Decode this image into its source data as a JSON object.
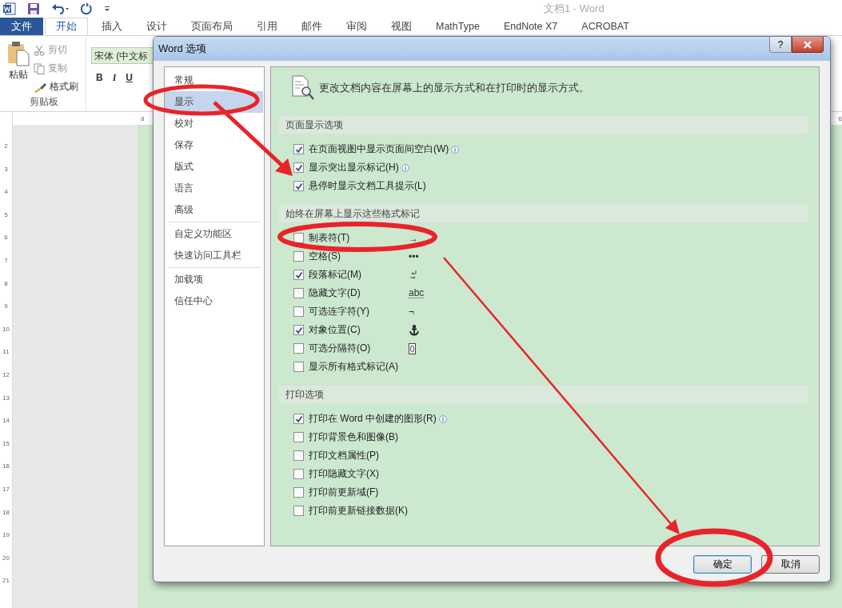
{
  "app": {
    "title": "文档1 - Word"
  },
  "tabs": [
    {
      "label": "文件",
      "kind": "file",
      "selected": false
    },
    {
      "label": "开始",
      "kind": "tab",
      "selected": true
    },
    {
      "label": "插入",
      "kind": "tab",
      "selected": false
    },
    {
      "label": "设计",
      "kind": "tab",
      "selected": false
    },
    {
      "label": "页面布局",
      "kind": "tab",
      "selected": false
    },
    {
      "label": "引用",
      "kind": "tab",
      "selected": false
    },
    {
      "label": "邮件",
      "kind": "tab",
      "selected": false
    },
    {
      "label": "审阅",
      "kind": "tab",
      "selected": false
    },
    {
      "label": "视图",
      "kind": "tab",
      "selected": false
    },
    {
      "label": "MathType",
      "kind": "tab",
      "selected": false
    },
    {
      "label": "EndNote X7",
      "kind": "tab",
      "selected": false
    },
    {
      "label": "ACROBAT",
      "kind": "tab",
      "selected": false
    }
  ],
  "clipboard": {
    "paste": "粘贴",
    "cut": "剪切",
    "copy": "复制",
    "format_painter": "格式刷",
    "group_label": "剪贴板"
  },
  "font": {
    "value": "宋体 (中文标",
    "bold": "B",
    "italic": "I",
    "underline": "U"
  },
  "ruler": {
    "top_labels": [
      "8",
      "6"
    ],
    "side_labels": [
      "2",
      "3",
      "4",
      "5",
      "6",
      "7",
      "8",
      "9",
      "10",
      "11",
      "12",
      "13",
      "14",
      "15",
      "16",
      "17",
      "18",
      "19",
      "20",
      "21"
    ]
  },
  "dialog": {
    "title": "Word 选项",
    "help": "?",
    "nav_groups": [
      [
        {
          "label": "常规",
          "selected": false
        },
        {
          "label": "显示",
          "selected": true
        },
        {
          "label": "校对",
          "selected": false
        },
        {
          "label": "保存",
          "selected": false
        },
        {
          "label": "版式",
          "selected": false
        },
        {
          "label": "语言",
          "selected": false
        },
        {
          "label": "高级",
          "selected": false
        }
      ],
      [
        {
          "label": "自定义功能区",
          "selected": false
        },
        {
          "label": "快速访问工具栏",
          "selected": false
        }
      ],
      [
        {
          "label": "加载项",
          "selected": false
        },
        {
          "label": "信任中心",
          "selected": false
        }
      ]
    ],
    "description": "更改文档内容在屏幕上的显示方式和在打印时的显示方式。",
    "sections": [
      {
        "title": "页面显示选项",
        "options": [
          {
            "label": "在页面视图中显示页面间空白(W)",
            "checked": true,
            "info": true
          },
          {
            "label": "显示突出显示标记(H)",
            "checked": true,
            "info": true
          },
          {
            "label": "悬停时显示文档工具提示(L)",
            "checked": true,
            "info": false
          }
        ]
      },
      {
        "title": "始终在屏幕上显示这些格式标记",
        "options": [
          {
            "label": "制表符(T)",
            "checked": false,
            "info": false,
            "mark": {
              "kind": "text",
              "text": "→"
            }
          },
          {
            "label": "空格(S)",
            "checked": false,
            "info": false,
            "mark": {
              "kind": "text",
              "text": "•••"
            }
          },
          {
            "label": "段落标记(M)",
            "checked": true,
            "info": false,
            "mark": {
              "kind": "paragraph"
            }
          },
          {
            "label": "隐藏文字(D)",
            "checked": false,
            "info": false,
            "mark": {
              "kind": "hidden",
              "text": "abc"
            }
          },
          {
            "label": "可选连字符(Y)",
            "checked": false,
            "info": false,
            "mark": {
              "kind": "text",
              "text": "¬"
            }
          },
          {
            "label": "对象位置(C)",
            "checked": true,
            "info": false,
            "mark": {
              "kind": "anchor"
            }
          },
          {
            "label": "可选分隔符(O)",
            "checked": false,
            "info": false,
            "mark": {
              "kind": "break"
            }
          },
          {
            "label": "显示所有格式标记(A)",
            "checked": false,
            "info": false
          }
        ]
      },
      {
        "title": "打印选项",
        "options": [
          {
            "label": "打印在 Word 中创建的图形(R)",
            "checked": true,
            "info": true
          },
          {
            "label": "打印背景色和图像(B)",
            "checked": false,
            "info": false
          },
          {
            "label": "打印文档属性(P)",
            "checked": false,
            "info": false
          },
          {
            "label": "打印隐藏文字(X)",
            "checked": false,
            "info": false
          },
          {
            "label": "打印前更新域(F)",
            "checked": false,
            "info": false
          },
          {
            "label": "打印前更新链接数据(K)",
            "checked": false,
            "info": false
          }
        ]
      }
    ],
    "buttons": [
      {
        "label": "确定",
        "focused": true
      },
      {
        "label": "取消",
        "focused": false
      }
    ]
  }
}
